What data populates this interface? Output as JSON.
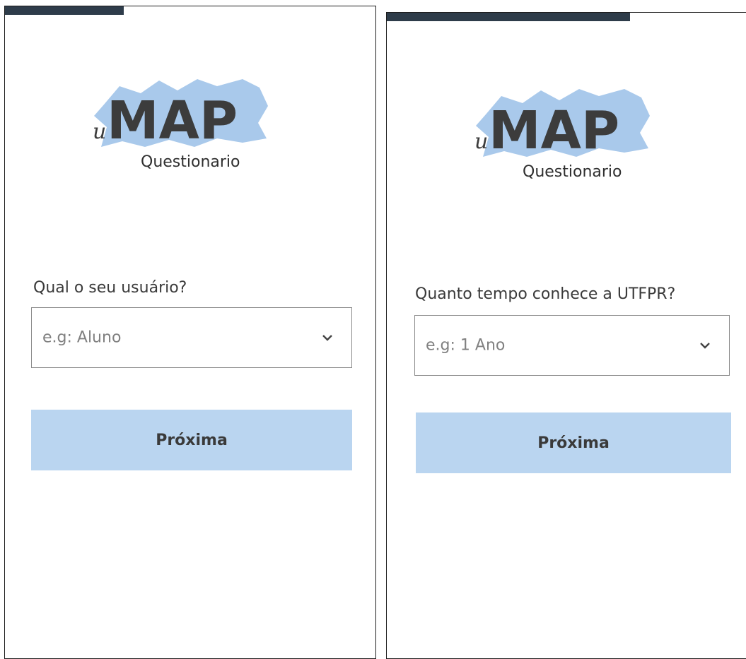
{
  "colors": {
    "progress": "#2e3c4a",
    "logo_blob": "#a9c9eb",
    "logo_text": "#3c3c3c",
    "button_bg": "#bad5f0",
    "border": "#8a8a8a"
  },
  "screens": [
    {
      "progress": 0.32,
      "logo": {
        "prefix": "u",
        "word": "MAP",
        "subtitle": "Questionario"
      },
      "question": "Qual o seu usuário?",
      "select_placeholder": "e.g: Aluno",
      "next_label": "Próxima"
    },
    {
      "progress": 0.67,
      "logo": {
        "prefix": "u",
        "word": "MAP",
        "subtitle": "Questionario"
      },
      "question": "Quanto tempo conhece a UTFPR?",
      "select_placeholder": "e.g: 1 Ano",
      "next_label": "Próxima"
    }
  ]
}
